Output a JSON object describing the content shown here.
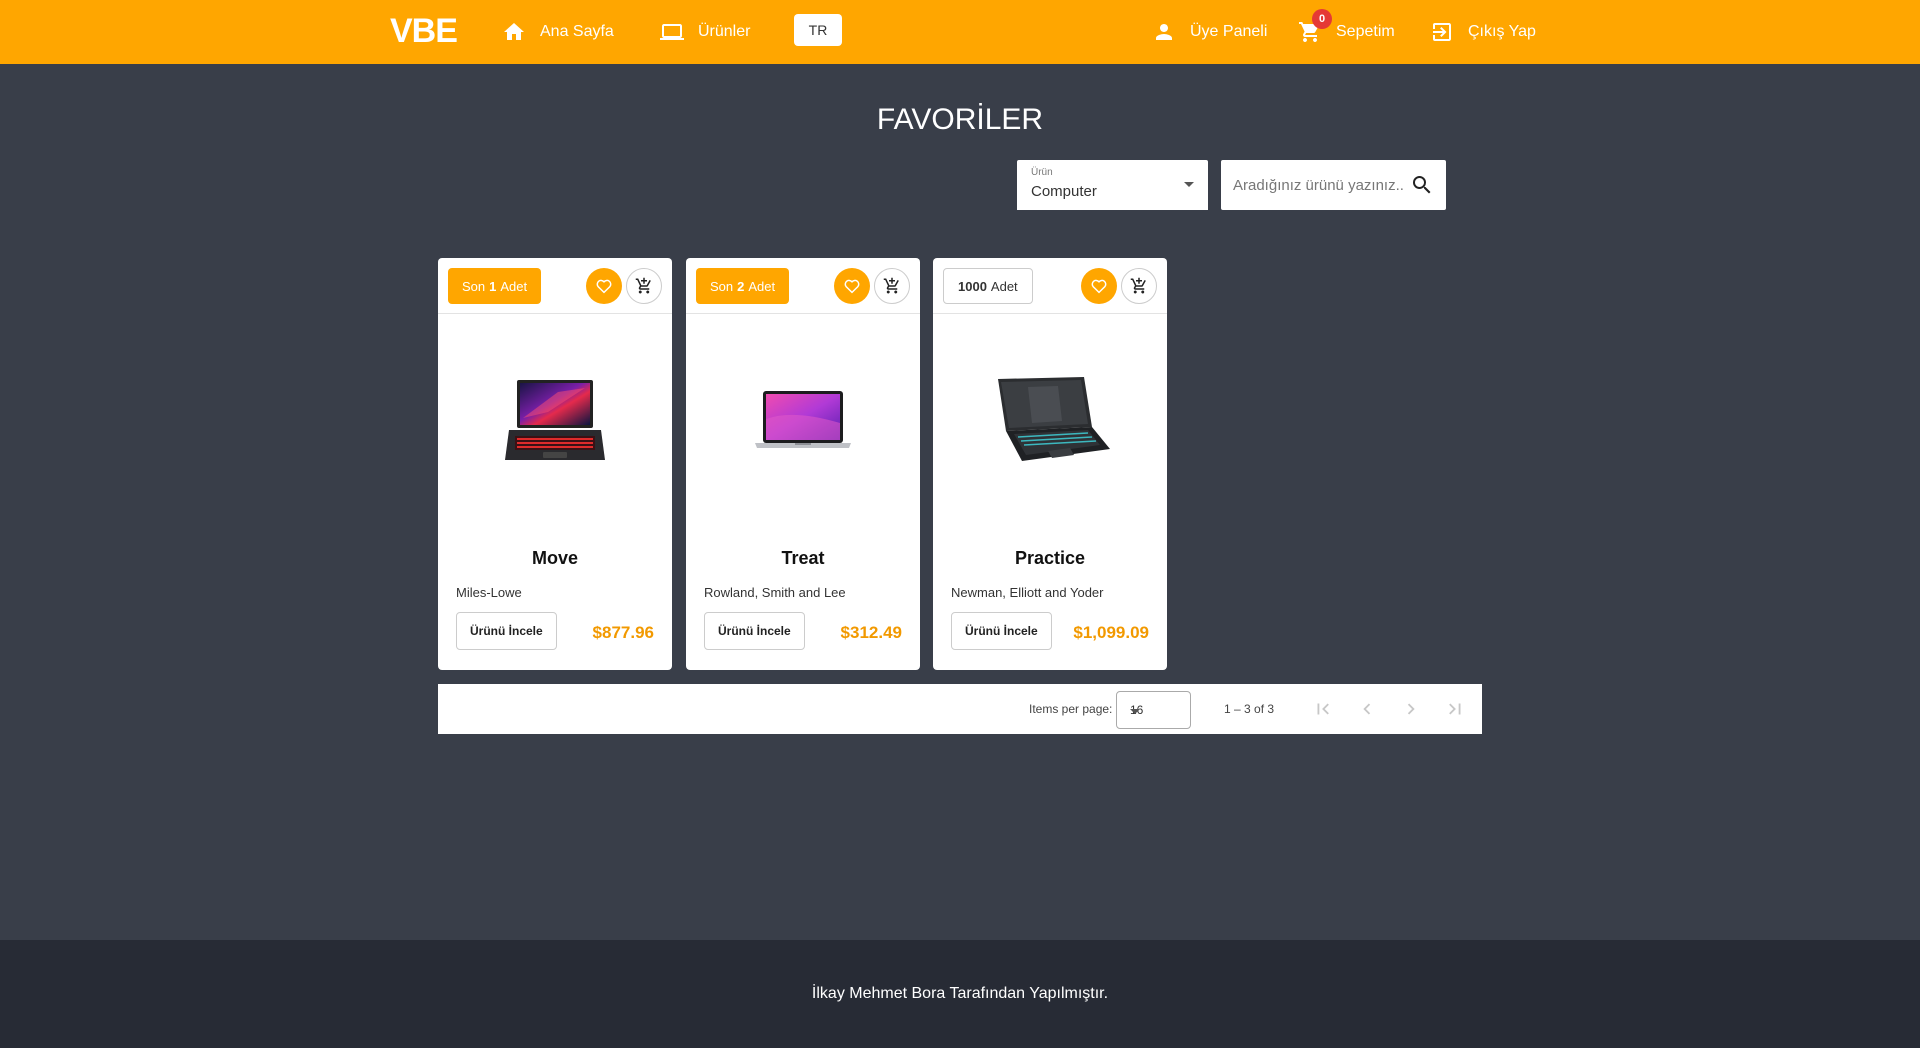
{
  "navbar": {
    "brand": "VBE",
    "home_label": "Ana Sayfa",
    "products_label": "Ürünler",
    "lang_label": "TR",
    "member_label": "Üye Paneli",
    "cart_label": "Sepetim",
    "cart_count": "0",
    "logout_label": "Çıkış Yap",
    "accent_color": "#ffa600"
  },
  "page": {
    "title": "FAVORİLER"
  },
  "filters": {
    "select_label": "Ürün",
    "select_value": "Computer",
    "search_placeholder": "Aradığınız ürünü yazınız..."
  },
  "cards": [
    {
      "stock_prefix": "Son",
      "stock_count": "1",
      "stock_suffix": "Adet",
      "stock_low": true,
      "name": "Move",
      "brand": "Miles-Lowe",
      "inspect_label": "Ürünü İncele",
      "price": "$877.96",
      "image": "gaming-laptop-red"
    },
    {
      "stock_prefix": "Son",
      "stock_count": "2",
      "stock_suffix": "Adet",
      "stock_low": true,
      "name": "Treat",
      "brand": "Rowland, Smith and Lee",
      "inspect_label": "Ürünü İncele",
      "price": "$312.49",
      "image": "macbook-purple"
    },
    {
      "stock_prefix": "",
      "stock_count": "1000",
      "stock_suffix": "Adet",
      "stock_low": false,
      "name": "Practice",
      "brand": "Newman, Elliott and Yoder",
      "inspect_label": "Ürünü İncele",
      "price": "$1,099.09",
      "image": "gaming-laptop-dark"
    }
  ],
  "paginator": {
    "items_per_page_label": "Items per page:",
    "items_per_page": "16",
    "range_label": "1 – 3 of 3"
  },
  "footer": {
    "text": "İlkay Mehmet Bora Tarafından Yapılmıştır."
  }
}
